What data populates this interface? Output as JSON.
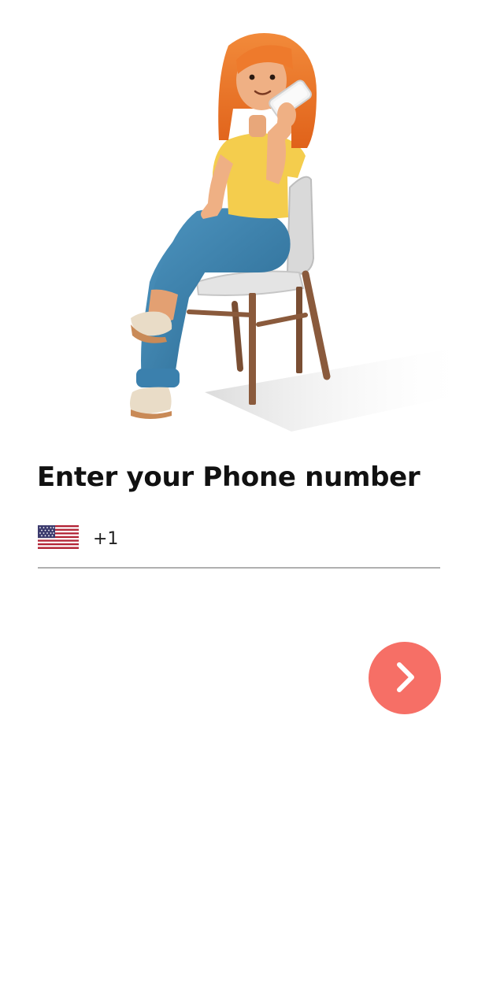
{
  "header": {
    "illustration_icon": "woman-on-phone-illustration"
  },
  "main": {
    "title": "Enter your Phone number",
    "phone": {
      "country_flag_icon": "us-flag-icon",
      "dial_code": "+1",
      "value": "",
      "placeholder": ""
    },
    "next_button_icon": "chevron-right-icon"
  },
  "colors": {
    "accent": "#f66f66",
    "underline": "#b0b0b0",
    "text": "#111111"
  }
}
